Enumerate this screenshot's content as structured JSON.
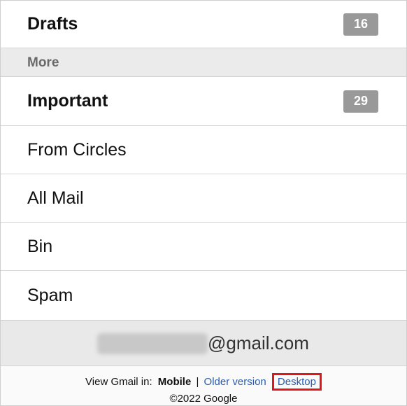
{
  "folders": {
    "drafts": {
      "label": "Drafts",
      "count": "16"
    },
    "more_header": "More",
    "important": {
      "label": "Important",
      "count": "29"
    },
    "from_circles": {
      "label": "From Circles"
    },
    "all_mail": {
      "label": "All Mail"
    },
    "bin": {
      "label": "Bin"
    },
    "spam": {
      "label": "Spam"
    }
  },
  "account": {
    "domain": "@gmail.com"
  },
  "footer": {
    "view_prefix": "View Gmail in:",
    "mobile": "Mobile",
    "separator": "|",
    "older_version": "Older version",
    "desktop": "Desktop",
    "copyright": "©2022 Google"
  },
  "colors": {
    "badge": "#999999",
    "section_bg": "#ebebeb",
    "link": "#2a5db0",
    "highlight_box": "#e0161b"
  }
}
